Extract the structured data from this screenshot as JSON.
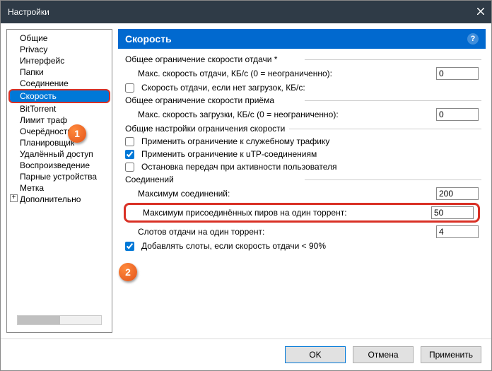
{
  "window": {
    "title": "Настройки"
  },
  "tree": {
    "items": [
      {
        "label": "Общие"
      },
      {
        "label": "Privacy"
      },
      {
        "label": "Интерфейс"
      },
      {
        "label": "Папки"
      },
      {
        "label": "Соединение"
      },
      {
        "label": "Скорость",
        "selected": true
      },
      {
        "label": "BitTorrent"
      },
      {
        "label": "Лимит траф"
      },
      {
        "label": "Очерёдность"
      },
      {
        "label": "Планировщик"
      },
      {
        "label": "Удалённый доступ"
      },
      {
        "label": "Воспроизведение"
      },
      {
        "label": "Парные устройства"
      },
      {
        "label": "Метка"
      },
      {
        "label": "Дополнительно",
        "plus": true
      }
    ]
  },
  "panel": {
    "title": "Скорость",
    "help": "?",
    "g1": {
      "title": "Общее ограничение скорости отдачи *",
      "maxup_label": "Макс. скорость отдачи, КБ/с (0 = неограниченно):",
      "maxup_value": "0",
      "altup_label": "Скорость отдачи, если нет загрузок, КБ/с:"
    },
    "g2": {
      "title": "Общее ограничение скорости приёма",
      "maxdl_label": "Макс. скорость загрузки, КБ/с (0 = неограниченно):",
      "maxdl_value": "0"
    },
    "g3": {
      "title": "Общие настройки ограничения скорости",
      "cb1": "Применить ограничение к служебному трафику",
      "cb2": "Применить ограничение к uTP-соединениям",
      "cb3": "Остановка передач при активности пользователя"
    },
    "g4": {
      "title": "Соединений",
      "maxconn_label": "Максимум соединений:",
      "maxconn_value": "200",
      "maxpeers_label": "Максимум присоединённых пиров на один торрент:",
      "maxpeers_value": "50",
      "slots_label": "Слотов отдачи на один торрент:",
      "slots_value": "4",
      "addslots_label": "Добавлять слоты, если скорость отдачи < 90%"
    }
  },
  "buttons": {
    "ok": "OK",
    "cancel": "Отмена",
    "apply": "Применить"
  },
  "callouts": {
    "one": "1",
    "two": "2"
  }
}
